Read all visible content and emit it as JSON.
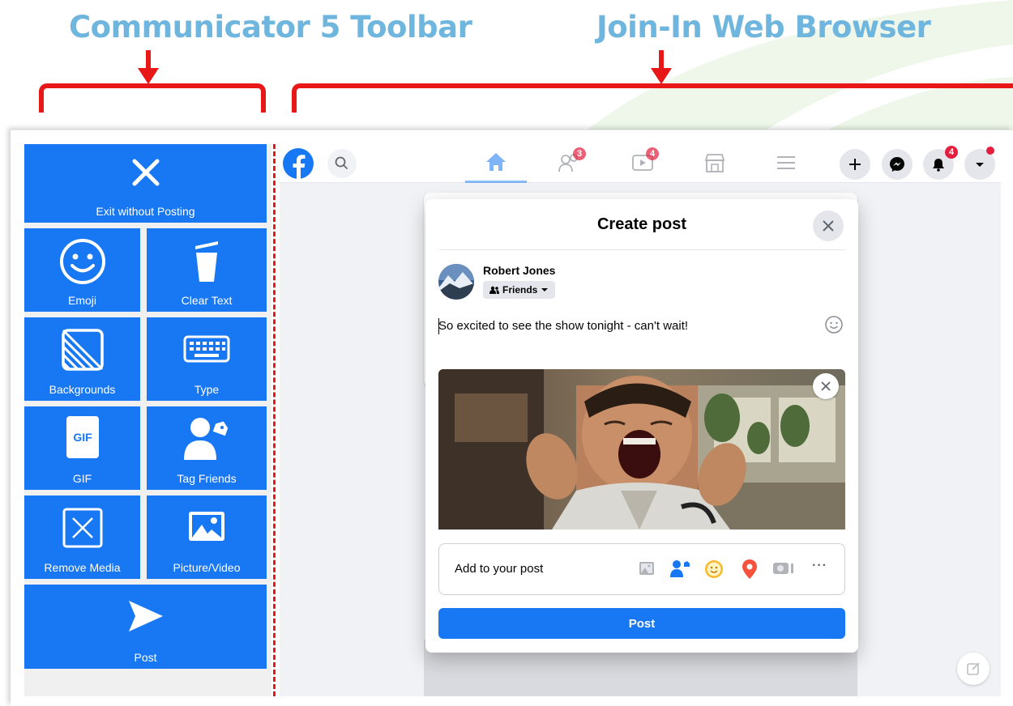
{
  "headings": {
    "left": "Communicator 5 Toolbar",
    "right": "Join-In Web Browser"
  },
  "colors": {
    "heading": "#6fb6df",
    "bracket": "#e81818",
    "toolbar_button": "#1877f2",
    "facebook_blue": "#1877f2",
    "badge_red": "#e41e3f"
  },
  "toolbar": {
    "buttons": [
      {
        "label": "Exit without Posting",
        "icon": "close-icon"
      },
      {
        "label": "Emoji",
        "icon": "smiley-icon"
      },
      {
        "label": "Clear Text",
        "icon": "trash-icon"
      },
      {
        "label": "Backgrounds",
        "icon": "background-icon"
      },
      {
        "label": "Type",
        "icon": "keyboard-icon"
      },
      {
        "label": "GIF",
        "icon": "gif-icon"
      },
      {
        "label": "Tag Friends",
        "icon": "tag-person-icon"
      },
      {
        "label": "Remove Media",
        "icon": "remove-media-icon"
      },
      {
        "label": "Picture/Video",
        "icon": "picture-icon"
      },
      {
        "label": "Post",
        "icon": "send-icon"
      }
    ]
  },
  "browser": {
    "nav": {
      "friends_badge": "3",
      "watch_badge": "4",
      "notifications_badge": "4"
    },
    "modal": {
      "title": "Create post",
      "user_name": "Robert Jones",
      "audience": "Friends",
      "post_text": "So excited to see the show tonight - can't wait!",
      "add_to_post_label": "Add to your post",
      "post_button": "Post",
      "more_label": "···"
    }
  }
}
